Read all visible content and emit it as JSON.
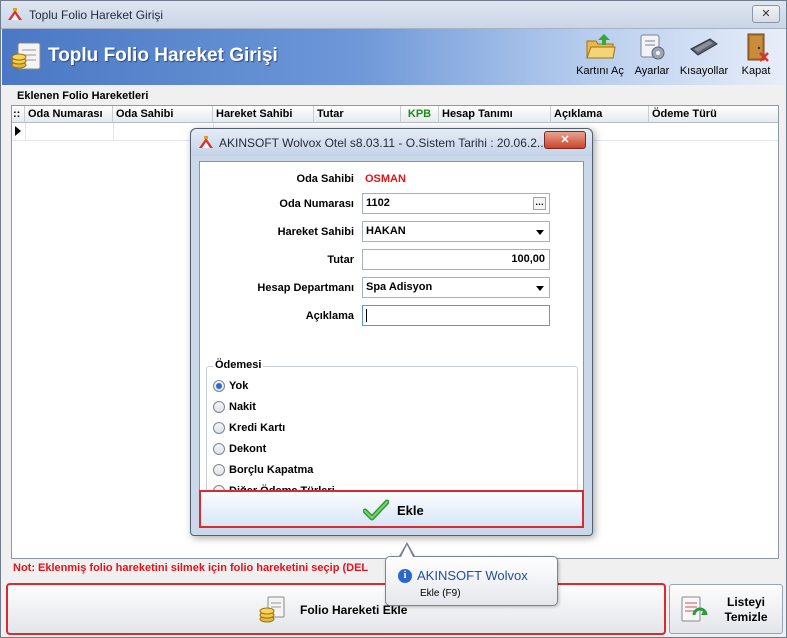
{
  "window": {
    "title": "Toplu Folio Hareket Girişi",
    "close_label": "✕"
  },
  "header": {
    "title": "Toplu Folio Hareket Girişi",
    "toolbar": [
      {
        "label": "Kartını Aç",
        "icon": "folder-open-icon"
      },
      {
        "label": "Ayarlar",
        "icon": "settings-icon"
      },
      {
        "label": "Kısayollar",
        "icon": "keyboard-icon"
      },
      {
        "label": "Kapat",
        "icon": "door-exit-icon"
      }
    ]
  },
  "grid": {
    "section_title": "Eklenen Folio Hareketleri",
    "header_marker": "::",
    "columns": [
      "Oda Numarası",
      "Oda Sahibi",
      "Hareket Sahibi",
      "Tutar",
      "KPB",
      "Hesap Tanımı",
      "Açıklama",
      "Ödeme Türü"
    ],
    "kpb_color": "#1a8a1a"
  },
  "note": "Not: Eklenmiş folio hareketini silmek için folio hareketini seçip (DEL",
  "buttons": {
    "add_folio": "Folio Hareketi Ekle",
    "clear_list_line1": "Listeyi",
    "clear_list_line2": "Temizle"
  },
  "dialog": {
    "title": "AKINSOFT Wolvox Otel s8.03.11 - O.Sistem Tarihi : 20.06.2...",
    "fields": {
      "oda_sahibi_label": "Oda Sahibi",
      "oda_sahibi_value": "OSMAN",
      "oda_numarasi_label": "Oda Numarası",
      "oda_numarasi_value": "1102",
      "hareket_sahibi_label": "Hareket Sahibi",
      "hareket_sahibi_value": "HAKAN",
      "tutar_label": "Tutar",
      "tutar_value": "100,00",
      "hesap_departmani_label": "Hesap Departmanı",
      "hesap_departmani_value": "Spa Adisyon",
      "aciklama_label": "Açıklama",
      "aciklama_value": ""
    },
    "odeme": {
      "title": "Ödemesi",
      "options": [
        "Yok",
        "Nakit",
        "Kredi Kartı",
        "Dekont",
        "Borçlu Kapatma",
        "Diğer Ödeme Türleri"
      ],
      "selected": "Yok"
    },
    "ekle_label": "Ekle",
    "owner_color": "#e0141b"
  },
  "tooltip": {
    "title": "AKINSOFT Wolvox",
    "subtitle": "Ekle (F9)"
  }
}
